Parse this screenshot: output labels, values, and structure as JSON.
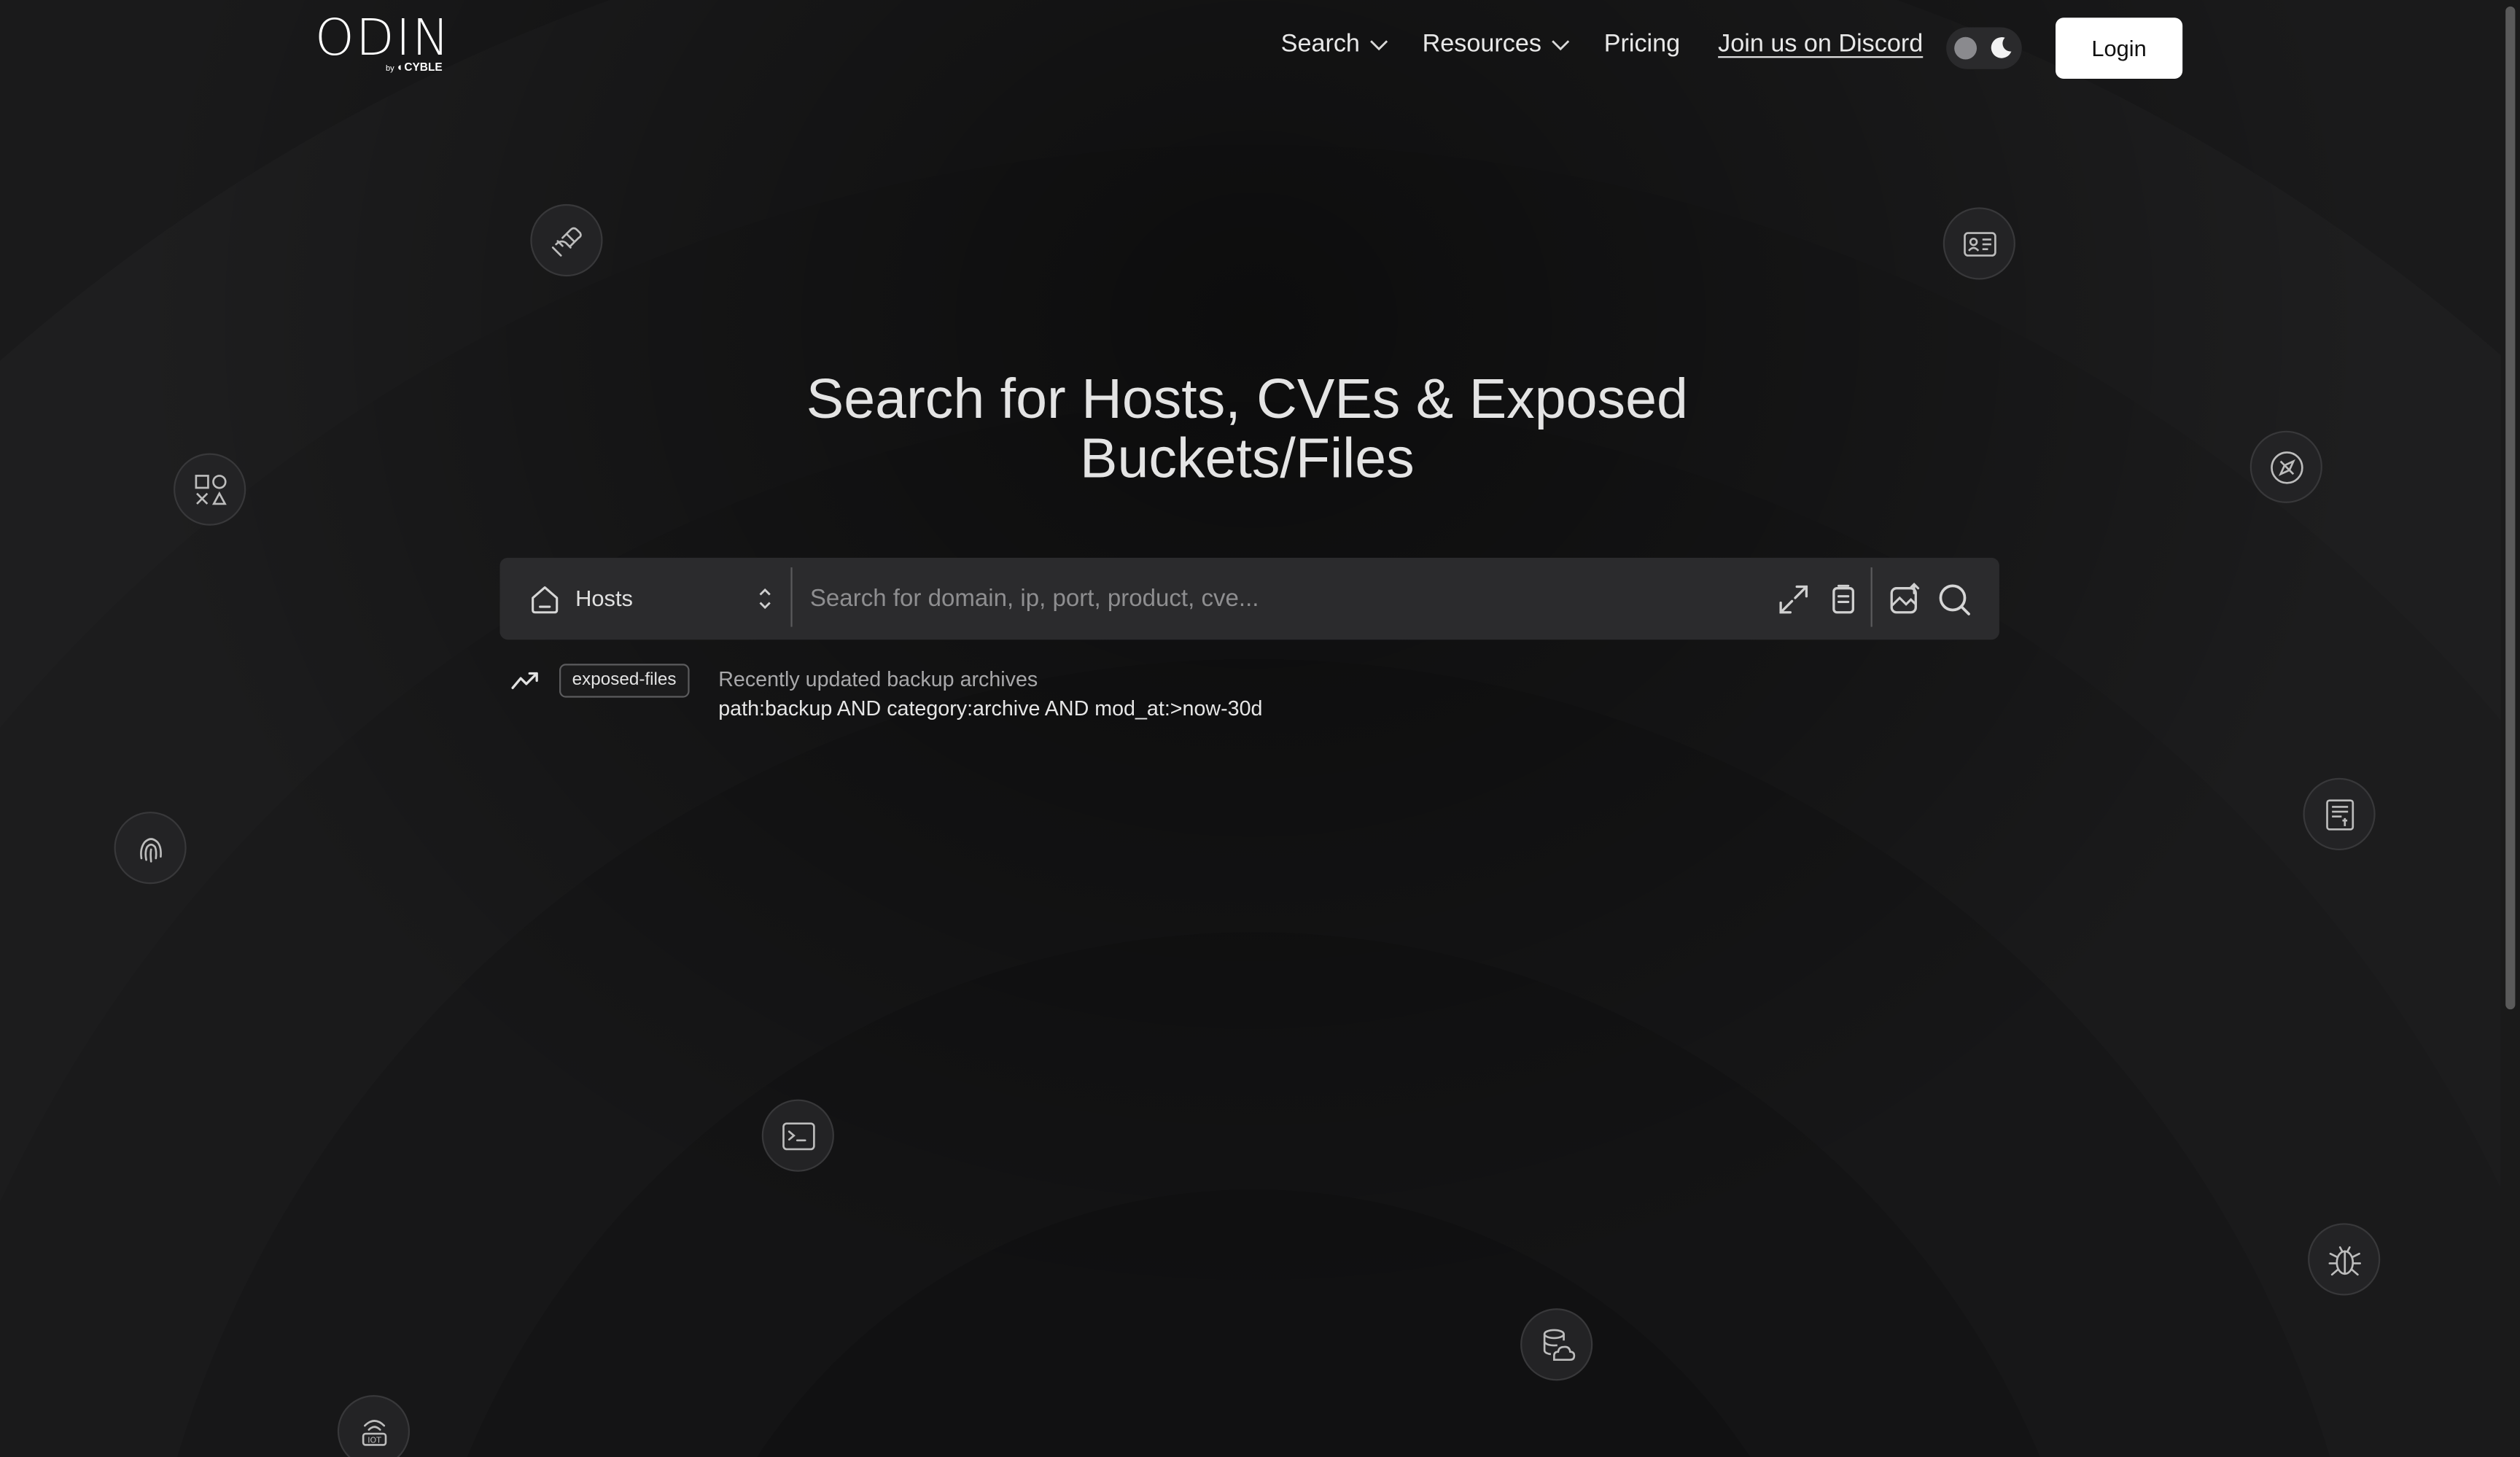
{
  "brand": {
    "logo_text": "ODIN",
    "by_text": "by",
    "company": "CYBLE"
  },
  "nav": {
    "search_label": "Search",
    "resources_label": "Resources",
    "pricing_label": "Pricing",
    "discord_label": "Join us on Discord",
    "login_label": "Login"
  },
  "theme_toggle": {
    "mode": "dark"
  },
  "hero": {
    "headline": "Search for Hosts, CVEs & Exposed Buckets/Files"
  },
  "search": {
    "category_selected": "Hosts",
    "placeholder": "Search for domain, ip, port, product, cve...",
    "value": ""
  },
  "suggestion": {
    "tag": "exposed-files",
    "title": "Recently updated backup archives",
    "query": "path:backup AND category:archive AND mod_at:>now-30d"
  },
  "floating_icons": [
    "handshake-icon",
    "id-card-icon",
    "shapes-icon",
    "compass-icon",
    "fingerprint-icon",
    "invoice-icon",
    "terminal-icon",
    "bug-icon",
    "cloud-database-icon",
    "iot-icon"
  ],
  "colors": {
    "background": "#111112",
    "search_bar": "#2b2b2d",
    "login_button_bg": "#ffffff",
    "text_primary": "#e4e4e4"
  }
}
